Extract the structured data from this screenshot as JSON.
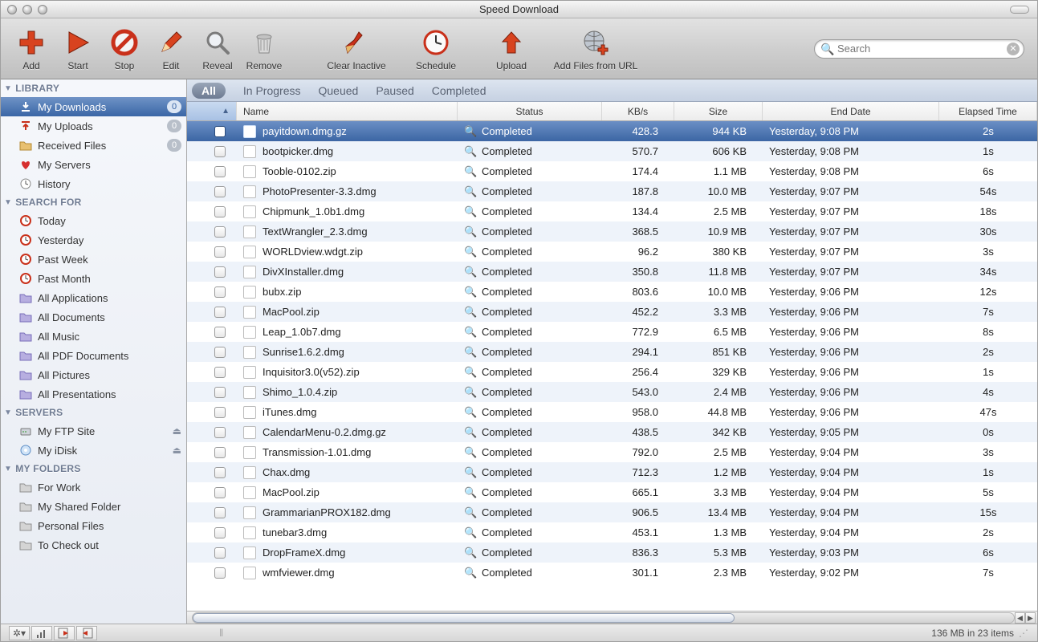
{
  "window": {
    "title": "Speed Download"
  },
  "toolbar": {
    "add": "Add",
    "start": "Start",
    "stop": "Stop",
    "edit": "Edit",
    "reveal": "Reveal",
    "remove": "Remove",
    "clear_inactive": "Clear Inactive",
    "schedule": "Schedule",
    "upload": "Upload",
    "add_url": "Add Files from URL",
    "search_placeholder": "Search"
  },
  "filters": {
    "all": "All",
    "in_progress": "In Progress",
    "queued": "Queued",
    "paused": "Paused",
    "completed": "Completed"
  },
  "columns": {
    "name": "Name",
    "status": "Status",
    "kbs": "KB/s",
    "size": "Size",
    "end": "End Date",
    "elapsed": "Elapsed Time"
  },
  "sidebar": {
    "library_hdr": "LIBRARY",
    "library": [
      {
        "label": "My Downloads",
        "badge": "0",
        "icon": "download"
      },
      {
        "label": "My Uploads",
        "badge": "0",
        "icon": "upload"
      },
      {
        "label": "Received Files",
        "badge": "0",
        "icon": "folder"
      },
      {
        "label": "My Servers",
        "icon": "heart"
      },
      {
        "label": "History",
        "icon": "clock"
      }
    ],
    "search_hdr": "SEARCH FOR",
    "search": [
      {
        "label": "Today",
        "icon": "clockred"
      },
      {
        "label": "Yesterday",
        "icon": "clockred"
      },
      {
        "label": "Past Week",
        "icon": "clockred"
      },
      {
        "label": "Past Month",
        "icon": "clockred"
      },
      {
        "label": "All Applications",
        "icon": "sfolder"
      },
      {
        "label": "All Documents",
        "icon": "sfolder"
      },
      {
        "label": "All Music",
        "icon": "sfolder"
      },
      {
        "label": "All PDF Documents",
        "icon": "sfolder"
      },
      {
        "label": "All Pictures",
        "icon": "sfolder"
      },
      {
        "label": "All Presentations",
        "icon": "sfolder"
      }
    ],
    "servers_hdr": "SERVERS",
    "servers": [
      {
        "label": "My FTP Site",
        "icon": "ftp",
        "eject": true
      },
      {
        "label": "My iDisk",
        "icon": "idisk",
        "eject": true
      }
    ],
    "folders_hdr": "MY FOLDERS",
    "folders": [
      {
        "label": "For Work",
        "icon": "gfolder"
      },
      {
        "label": "My Shared Folder",
        "icon": "gfolder"
      },
      {
        "label": "Personal Files",
        "icon": "gfolder"
      },
      {
        "label": "To Check out",
        "icon": "gfolder"
      }
    ]
  },
  "rows": [
    {
      "name": "payitdown.dmg.gz",
      "status": "Completed",
      "kbs": "428.3",
      "size": "944 KB",
      "end": "Yesterday, 9:08 PM",
      "elapsed": "2s",
      "sel": true
    },
    {
      "name": "bootpicker.dmg",
      "status": "Completed",
      "kbs": "570.7",
      "size": "606 KB",
      "end": "Yesterday, 9:08 PM",
      "elapsed": "1s"
    },
    {
      "name": "Tooble-0102.zip",
      "status": "Completed",
      "kbs": "174.4",
      "size": "1.1 MB",
      "end": "Yesterday, 9:08 PM",
      "elapsed": "6s"
    },
    {
      "name": "PhotoPresenter-3.3.dmg",
      "status": "Completed",
      "kbs": "187.8",
      "size": "10.0 MB",
      "end": "Yesterday, 9:07 PM",
      "elapsed": "54s"
    },
    {
      "name": "Chipmunk_1.0b1.dmg",
      "status": "Completed",
      "kbs": "134.4",
      "size": "2.5 MB",
      "end": "Yesterday, 9:07 PM",
      "elapsed": "18s"
    },
    {
      "name": "TextWrangler_2.3.dmg",
      "status": "Completed",
      "kbs": "368.5",
      "size": "10.9 MB",
      "end": "Yesterday, 9:07 PM",
      "elapsed": "30s"
    },
    {
      "name": "WORLDview.wdgt.zip",
      "status": "Completed",
      "kbs": "96.2",
      "size": "380 KB",
      "end": "Yesterday, 9:07 PM",
      "elapsed": "3s"
    },
    {
      "name": "DivXInstaller.dmg",
      "status": "Completed",
      "kbs": "350.8",
      "size": "11.8 MB",
      "end": "Yesterday, 9:07 PM",
      "elapsed": "34s"
    },
    {
      "name": "bubx.zip",
      "status": "Completed",
      "kbs": "803.6",
      "size": "10.0 MB",
      "end": "Yesterday, 9:06 PM",
      "elapsed": "12s"
    },
    {
      "name": "MacPool.zip",
      "status": "Completed",
      "kbs": "452.2",
      "size": "3.3 MB",
      "end": "Yesterday, 9:06 PM",
      "elapsed": "7s"
    },
    {
      "name": "Leap_1.0b7.dmg",
      "status": "Completed",
      "kbs": "772.9",
      "size": "6.5 MB",
      "end": "Yesterday, 9:06 PM",
      "elapsed": "8s"
    },
    {
      "name": "Sunrise1.6.2.dmg",
      "status": "Completed",
      "kbs": "294.1",
      "size": "851 KB",
      "end": "Yesterday, 9:06 PM",
      "elapsed": "2s"
    },
    {
      "name": "Inquisitor3.0(v52).zip",
      "status": "Completed",
      "kbs": "256.4",
      "size": "329 KB",
      "end": "Yesterday, 9:06 PM",
      "elapsed": "1s"
    },
    {
      "name": "Shimo_1.0.4.zip",
      "status": "Completed",
      "kbs": "543.0",
      "size": "2.4 MB",
      "end": "Yesterday, 9:06 PM",
      "elapsed": "4s"
    },
    {
      "name": "iTunes.dmg",
      "status": "Completed",
      "kbs": "958.0",
      "size": "44.8 MB",
      "end": "Yesterday, 9:06 PM",
      "elapsed": "47s"
    },
    {
      "name": "CalendarMenu-0.2.dmg.gz",
      "status": "Completed",
      "kbs": "438.5",
      "size": "342 KB",
      "end": "Yesterday, 9:05 PM",
      "elapsed": "0s"
    },
    {
      "name": "Transmission-1.01.dmg",
      "status": "Completed",
      "kbs": "792.0",
      "size": "2.5 MB",
      "end": "Yesterday, 9:04 PM",
      "elapsed": "3s"
    },
    {
      "name": "Chax.dmg",
      "status": "Completed",
      "kbs": "712.3",
      "size": "1.2 MB",
      "end": "Yesterday, 9:04 PM",
      "elapsed": "1s"
    },
    {
      "name": "MacPool.zip",
      "status": "Completed",
      "kbs": "665.1",
      "size": "3.3 MB",
      "end": "Yesterday, 9:04 PM",
      "elapsed": "5s"
    },
    {
      "name": "GrammarianPROX182.dmg",
      "status": "Completed",
      "kbs": "906.5",
      "size": "13.4 MB",
      "end": "Yesterday, 9:04 PM",
      "elapsed": "15s"
    },
    {
      "name": "tunebar3.dmg",
      "status": "Completed",
      "kbs": "453.1",
      "size": "1.3 MB",
      "end": "Yesterday, 9:04 PM",
      "elapsed": "2s"
    },
    {
      "name": "DropFrameX.dmg",
      "status": "Completed",
      "kbs": "836.3",
      "size": "5.3 MB",
      "end": "Yesterday, 9:03 PM",
      "elapsed": "6s"
    },
    {
      "name": "wmfviewer.dmg",
      "status": "Completed",
      "kbs": "301.1",
      "size": "2.3 MB",
      "end": "Yesterday, 9:02 PM",
      "elapsed": "7s"
    }
  ],
  "status": {
    "summary": "136 MB in 23 items"
  }
}
